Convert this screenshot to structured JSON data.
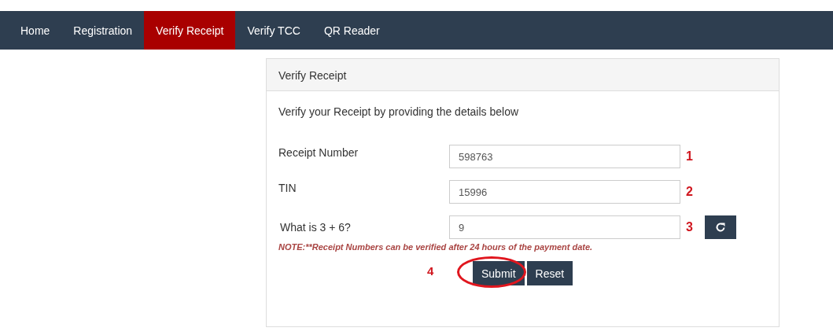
{
  "nav": {
    "items": [
      {
        "label": "Home",
        "selected": false
      },
      {
        "label": "Registration",
        "selected": false
      },
      {
        "label": "Verify Receipt",
        "selected": true
      },
      {
        "label": "Verify TCC",
        "selected": false
      },
      {
        "label": "QR Reader",
        "selected": false
      }
    ]
  },
  "panel": {
    "title": "Verify Receipt",
    "intro": "Verify your Receipt by providing the details below",
    "fields": [
      {
        "label": "Receipt Number",
        "value": "598763",
        "marker": "1",
        "kind": "text"
      },
      {
        "label": "TIN",
        "value": "15996",
        "marker": "2",
        "kind": "text"
      },
      {
        "label": "What is 3 + 6?",
        "value": "9",
        "marker": "3",
        "kind": "captcha"
      }
    ],
    "note": "NOTE:**Receipt Numbers can be verified after 24 hours of the payment date.",
    "actions_marker": "4",
    "buttons": [
      {
        "label": "Submit",
        "highlighted": true
      },
      {
        "label": "Reset",
        "highlighted": false
      }
    ]
  }
}
